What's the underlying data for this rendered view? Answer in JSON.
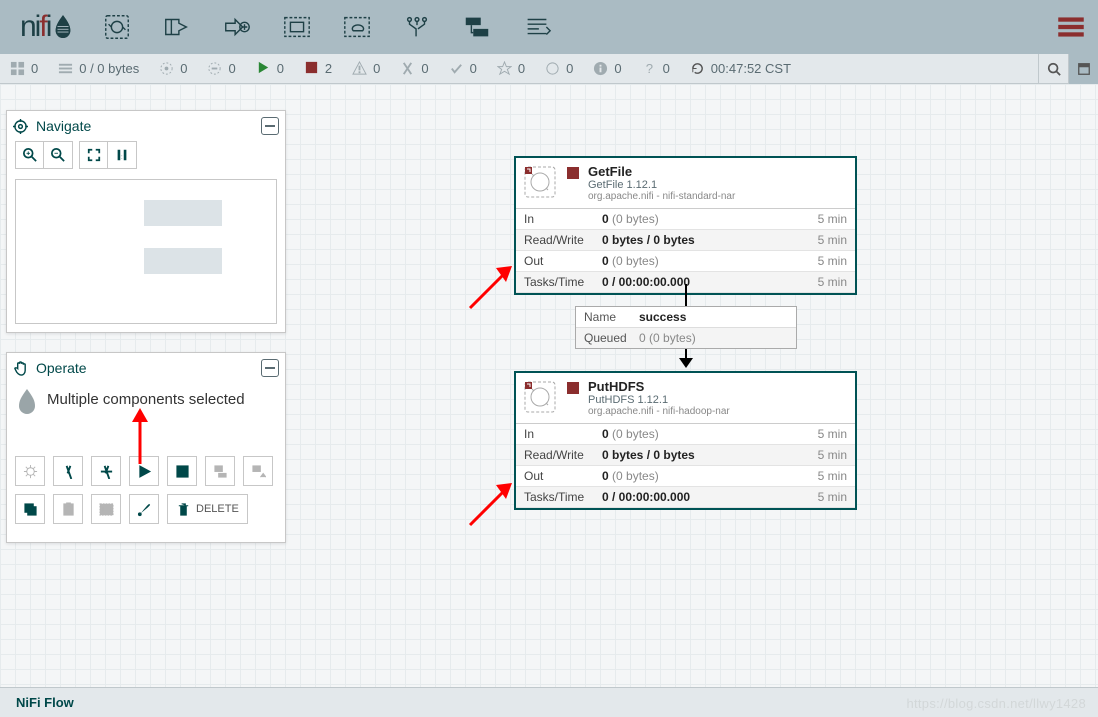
{
  "status": {
    "threads": "0",
    "queue": "0 / 0 bytes",
    "remote_tx": "0",
    "remote_rx": "0",
    "running": "0",
    "stopped": "2",
    "invalid": "0",
    "disabled": "0",
    "uptodate": "0",
    "stale": "0",
    "sync_fail": "0",
    "bulletin": "0",
    "unknown": "0",
    "refreshed": "00:47:52 CST"
  },
  "panels": {
    "navigate_title": "Navigate",
    "operate_title": "Operate",
    "operate_selection": "Multiple components selected",
    "delete_label": "DELETE"
  },
  "connection": {
    "name_label": "Name",
    "name_value": "success",
    "queued_label": "Queued",
    "queued_value": "0",
    "queued_extra": "(0 bytes)"
  },
  "processors": [
    {
      "name": "GetFile",
      "type": "GetFile 1.12.1",
      "bundle": "org.apache.nifi - nifi-standard-nar",
      "rows": [
        {
          "label": "In",
          "value": "0",
          "extra": "(0 bytes)",
          "win": "5 min"
        },
        {
          "label": "Read/Write",
          "value": "0 bytes / 0 bytes",
          "extra": "",
          "win": "5 min"
        },
        {
          "label": "Out",
          "value": "0",
          "extra": "(0 bytes)",
          "win": "5 min"
        },
        {
          "label": "Tasks/Time",
          "value": "0 / 00:00:00.000",
          "extra": "",
          "win": "5 min"
        }
      ]
    },
    {
      "name": "PutHDFS",
      "type": "PutHDFS 1.12.1",
      "bundle": "org.apache.nifi - nifi-hadoop-nar",
      "rows": [
        {
          "label": "In",
          "value": "0",
          "extra": "(0 bytes)",
          "win": "5 min"
        },
        {
          "label": "Read/Write",
          "value": "0 bytes / 0 bytes",
          "extra": "",
          "win": "5 min"
        },
        {
          "label": "Out",
          "value": "0",
          "extra": "(0 bytes)",
          "win": "5 min"
        },
        {
          "label": "Tasks/Time",
          "value": "0 / 00:00:00.000",
          "extra": "",
          "win": "5 min"
        }
      ]
    }
  ],
  "footer": {
    "breadcrumb": "NiFi Flow"
  },
  "watermark": "https://blog.csdn.net/llwy1428"
}
